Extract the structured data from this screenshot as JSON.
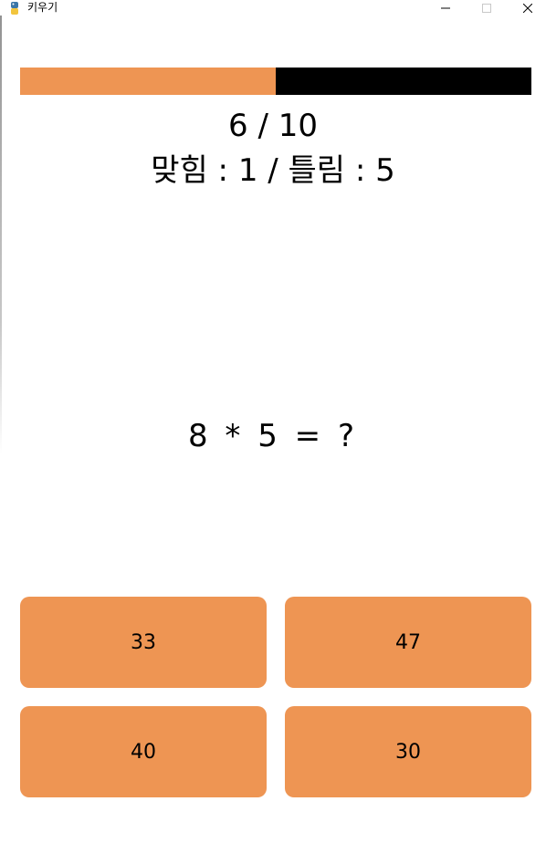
{
  "window": {
    "title": "키우기",
    "icon": "python-icon"
  },
  "progress": {
    "current": 6,
    "total": 10,
    "fill_color": "#ee9553",
    "track_color": "#000000"
  },
  "counter_text": "6 / 10",
  "score_text": "맞힘 : 1 / 틀림 : 5",
  "question_text": "8 * 5 = ?",
  "answers": [
    {
      "label": "33"
    },
    {
      "label": "47"
    },
    {
      "label": "40"
    },
    {
      "label": "30"
    }
  ],
  "colors": {
    "accent": "#ee9553",
    "background": "#ffffff",
    "text": "#000000"
  }
}
